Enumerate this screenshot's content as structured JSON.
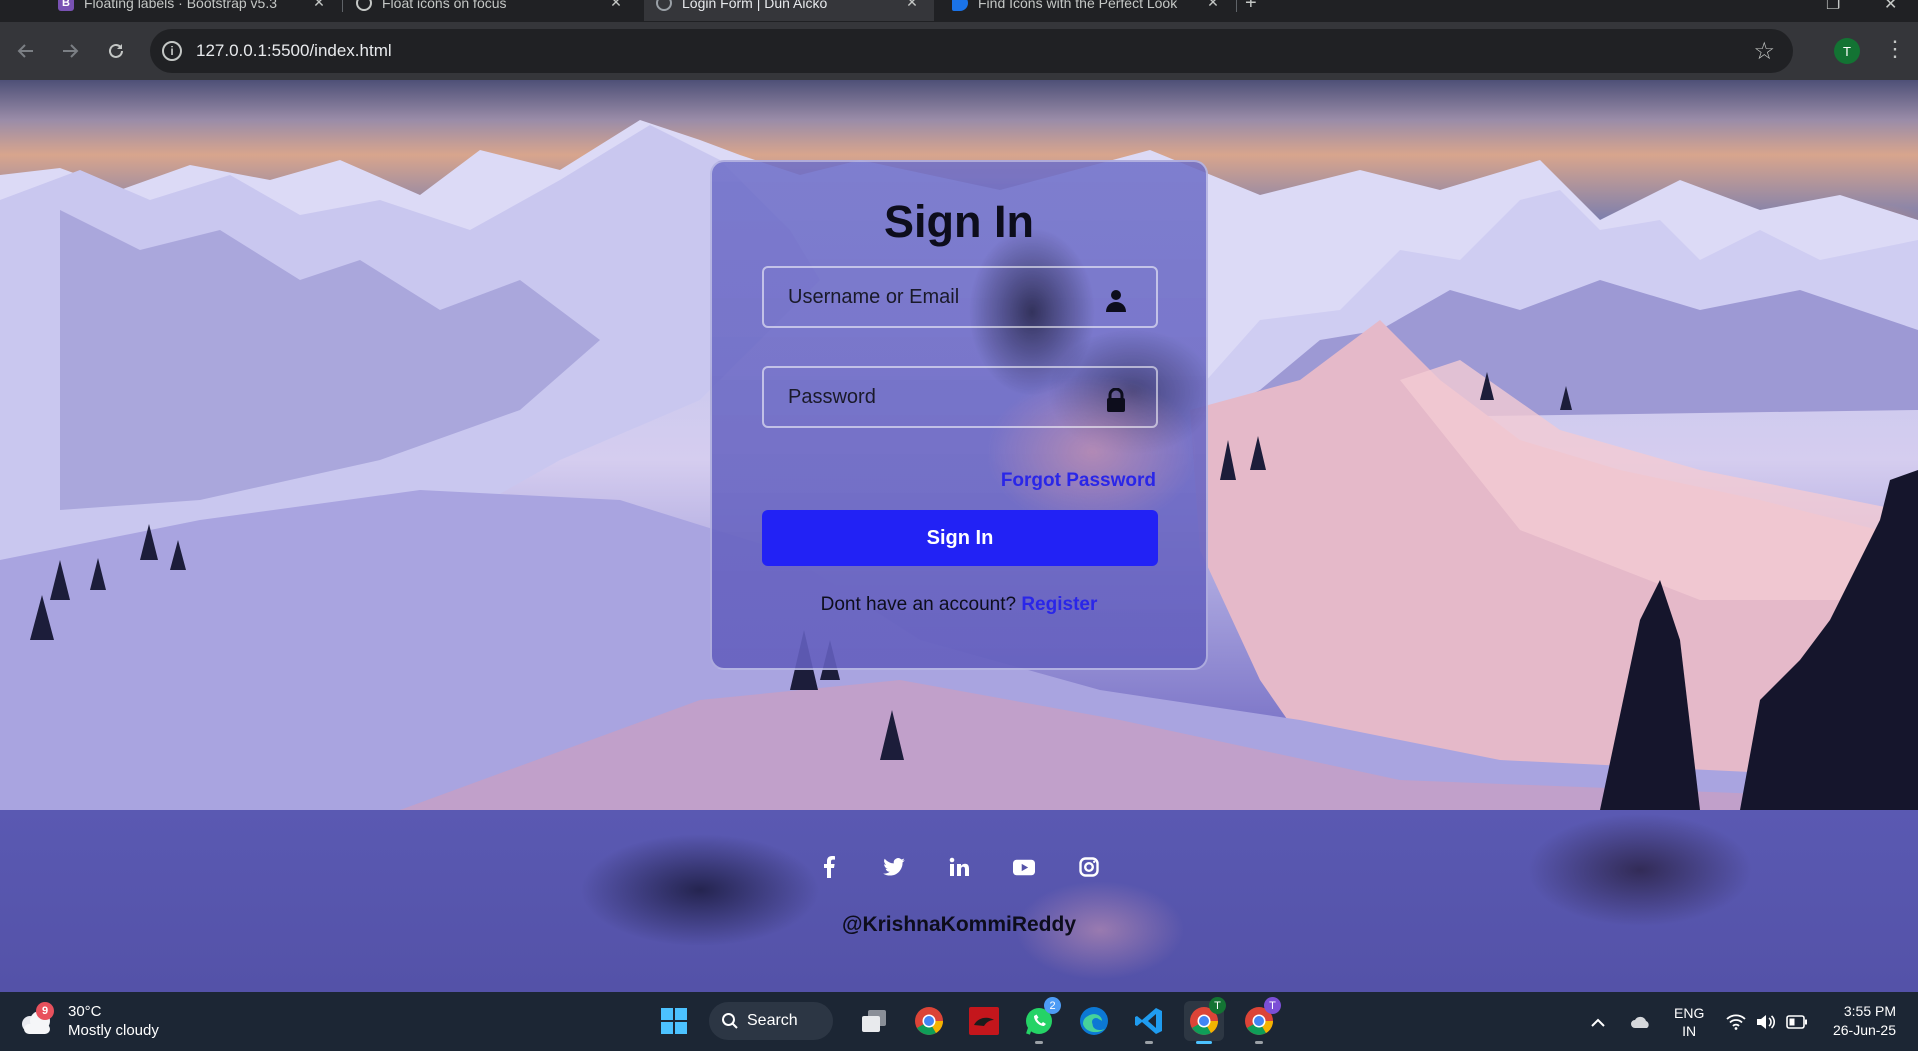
{
  "browser": {
    "tabs": [
      {
        "title": "Floating labels · Bootstrap v5.3",
        "icon": "bootstrap-icon",
        "active": false
      },
      {
        "title": "Float icons on focus",
        "icon": "codepen-icon",
        "active": false
      },
      {
        "title": "Login Form | Dun Aicko",
        "icon": "globe-icon",
        "active": true
      },
      {
        "title": "Find Icons with the Perfect Look",
        "icon": "flag-icon",
        "active": false
      }
    ],
    "url": "127.0.0.1:5500/index.html",
    "profile_initial": "T"
  },
  "login": {
    "title": "Sign In",
    "username_placeholder": "Username or Email",
    "password_placeholder": "Password",
    "forgot_label": "Forgot Password",
    "submit_label": "Sign In",
    "register_prompt": "Dont have an account?",
    "register_label": "Register"
  },
  "footer": {
    "socials": [
      "facebook-icon",
      "twitter-icon",
      "linkedin-icon",
      "youtube-icon",
      "instagram-icon"
    ],
    "handle": "@KrishnaKommiReddy"
  },
  "taskbar": {
    "weather_temp": "30°C",
    "weather_desc": "Mostly cloudy",
    "weather_badge": "9",
    "search_label": "Search",
    "whatsapp_badge": "2",
    "chrome_profile_badge_1": "T",
    "chrome_profile_badge_2": "T",
    "lang_line1": "ENG",
    "lang_line2": "IN",
    "time": "3:55 PM",
    "date": "26-Jun-25"
  },
  "colors": {
    "accent": "#2222f5",
    "link": "#2a26e8",
    "taskbar": "#1c2634"
  }
}
